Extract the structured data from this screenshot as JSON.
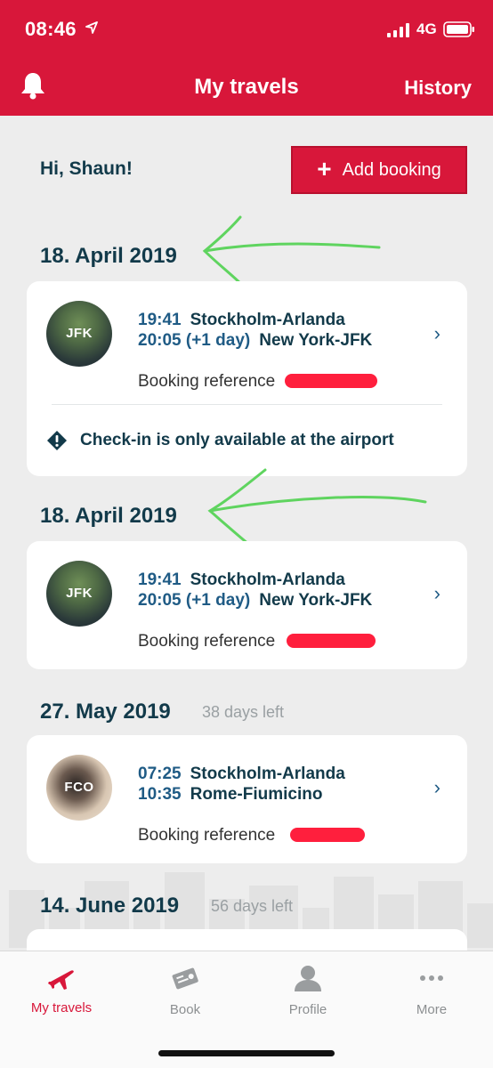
{
  "status_bar": {
    "time": "08:46",
    "network": "4G",
    "icons": [
      "location-arrow-icon",
      "signal-icon",
      "battery-icon"
    ]
  },
  "header": {
    "title": "My travels",
    "history_label": "History",
    "left_icon": "bell-icon",
    "color": "#d8173a"
  },
  "greeting": "Hi, Shaun!",
  "add_booking": {
    "label": "Add booking",
    "icon": "plus-icon"
  },
  "trips": [
    {
      "date": "18. April 2019",
      "days_left": "",
      "avatar_code": "JFK",
      "depart_time": "19:41",
      "depart_place": "Stockholm-Arlanda",
      "arrive_time": "20:05 (+1 day)",
      "arrive_place": "New York-JFK",
      "booking_ref_label": "Booking reference",
      "notice": "Check-in is only available at the airport"
    },
    {
      "date": "18. April 2019",
      "days_left": "",
      "avatar_code": "JFK",
      "depart_time": "19:41",
      "depart_place": "Stockholm-Arlanda",
      "arrive_time": "20:05 (+1 day)",
      "arrive_place": "New York-JFK",
      "booking_ref_label": "Booking reference"
    },
    {
      "date": "27. May 2019",
      "days_left": "38 days left",
      "avatar_code": "FCO",
      "depart_time": "07:25",
      "depart_place": "Stockholm-Arlanda",
      "arrive_time": "10:35",
      "arrive_place": "Rome-Fiumicino",
      "booking_ref_label": "Booking reference"
    },
    {
      "date": "14. June 2019",
      "days_left": "56 days left"
    }
  ],
  "tabbar": {
    "tabs": [
      {
        "label": "My travels",
        "icon": "airplane-icon",
        "active": true
      },
      {
        "label": "Book",
        "icon": "ticket-icon",
        "active": false
      },
      {
        "label": "Profile",
        "icon": "person-icon",
        "active": false
      },
      {
        "label": "More",
        "icon": "more-dots-icon",
        "active": false
      }
    ]
  },
  "colors": {
    "accent": "#d8173a",
    "text_dark": "#123a4a",
    "time_blue": "#1f5b85",
    "annotation_green": "#5fd45f"
  }
}
